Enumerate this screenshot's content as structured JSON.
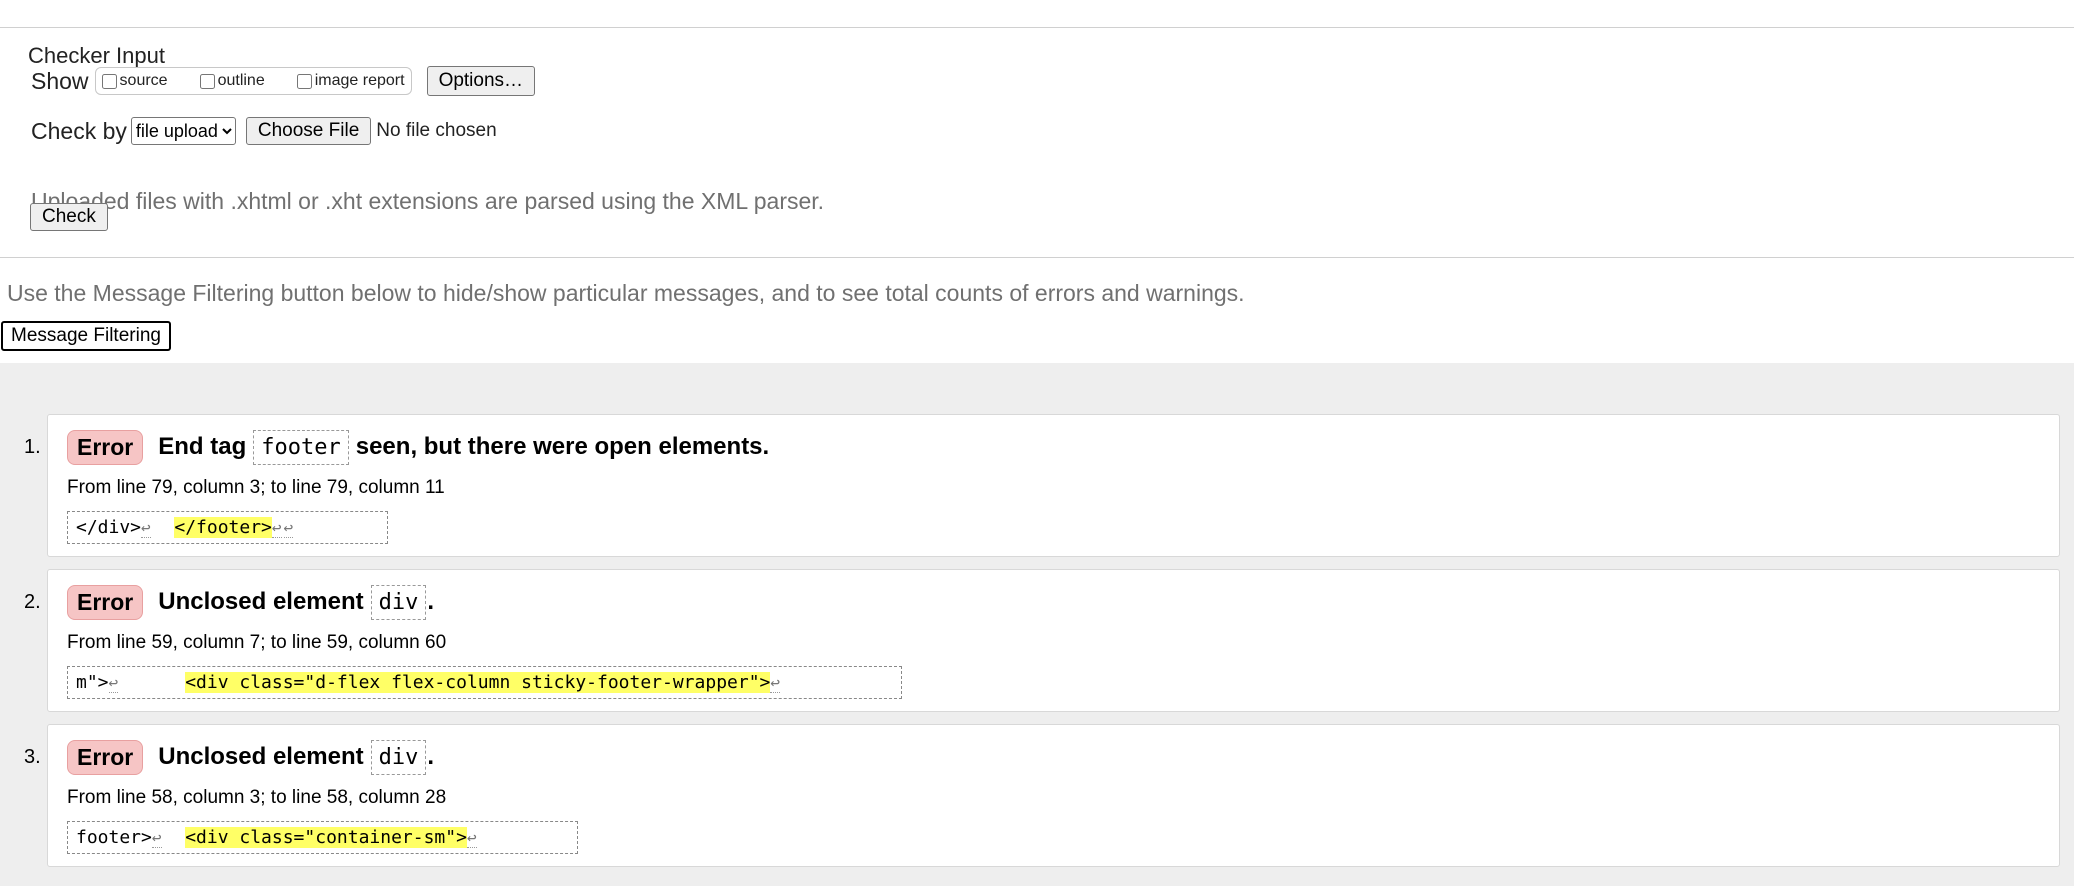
{
  "checker": {
    "legend": "Checker Input",
    "show_label": "Show",
    "show_options": [
      "source",
      "outline",
      "image report"
    ],
    "options_button": "Options…",
    "check_by_label": "Check by",
    "check_by_value": "file upload",
    "choose_file_button": "Choose File",
    "no_file_text": "No file chosen",
    "note": "Uploaded files with .xhtml or .xht extensions are parsed using the XML parser.",
    "check_button": "Check"
  },
  "filtering": {
    "note": "Use the Message Filtering button below to hide/show particular messages, and to see total counts of errors and warnings.",
    "button": "Message Filtering"
  },
  "messages": [
    {
      "number": "1.",
      "type": "Error",
      "title_before": "End tag",
      "code": "footer",
      "title_after": "seen, but there were open elements.",
      "location": "From line 79, column 3; to line 79, column 11",
      "extract_before": "</div>",
      "extract_mid": "  ",
      "extract_highlight": "</footer>",
      "extract_after": ""
    },
    {
      "number": "2.",
      "type": "Error",
      "title_before": "Unclosed element",
      "code": "div",
      "title_after": ".",
      "location": "From line 59, column 7; to line 59, column 60",
      "extract_before": "m\">",
      "extract_mid": "      ",
      "extract_highlight": "<div class=\"d-flex flex-column sticky-footer-wrapper\">",
      "extract_after": ""
    },
    {
      "number": "3.",
      "type": "Error",
      "title_before": "Unclosed element",
      "code": "div",
      "title_after": ".",
      "location": "From line 58, column 3; to line 58, column 28",
      "extract_before": "footer>",
      "extract_mid": "  ",
      "extract_highlight": "<div class=\"container-sm\">",
      "extract_after": ""
    }
  ],
  "icons": {
    "return": "return-arrow-icon"
  },
  "colors": {
    "error_badge": "#f6c5c5",
    "highlight": "#ffff66",
    "results_bg": "#eeeeee"
  }
}
